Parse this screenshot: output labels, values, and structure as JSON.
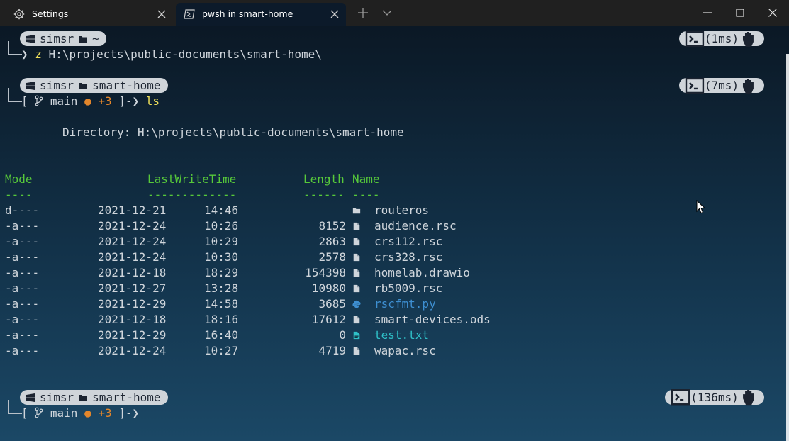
{
  "tabs": [
    {
      "label": "Settings",
      "icon": "gear-icon",
      "active": false
    },
    {
      "label": "pwsh in smart-home",
      "icon": "powershell-icon",
      "active": true
    }
  ],
  "prompts": [
    {
      "user": "simsr",
      "dir": "~",
      "time": "(1ms)",
      "command_prefix": "z",
      "command_arg": "H:\\projects\\public-documents\\smart-home\\"
    },
    {
      "user": "simsr",
      "dir": "smart-home",
      "time": "(7ms)",
      "branch": "main",
      "dirty": "●",
      "changes": "+3",
      "command": "ls"
    },
    {
      "user": "simsr",
      "dir": "smart-home",
      "time": "(136ms)",
      "branch": "main",
      "dirty": "●",
      "changes": "+3",
      "command": ""
    }
  ],
  "listing": {
    "directory": "Directory: H:\\projects\\public-documents\\smart-home",
    "headers": {
      "mode": "Mode",
      "lastwrite": "LastWriteTime",
      "length": "Length",
      "name": "Name"
    },
    "underlines": {
      "mode": "----",
      "lastwrite": "-------------",
      "length": "------",
      "name": "----"
    },
    "rows": [
      {
        "mode": "d----",
        "date": "2021-12-21",
        "time": "14:46",
        "length": "",
        "name": "routeros",
        "icon": "folder-icon",
        "color": "#cfd5db"
      },
      {
        "mode": "-a---",
        "date": "2021-12-24",
        "time": "10:26",
        "length": "8152",
        "name": "audience.rsc",
        "icon": "file-icon",
        "color": "#cfd5db"
      },
      {
        "mode": "-a---",
        "date": "2021-12-24",
        "time": "10:29",
        "length": "2863",
        "name": "crs112.rsc",
        "icon": "file-icon",
        "color": "#cfd5db"
      },
      {
        "mode": "-a---",
        "date": "2021-12-24",
        "time": "10:30",
        "length": "2578",
        "name": "crs328.rsc",
        "icon": "file-icon",
        "color": "#cfd5db"
      },
      {
        "mode": "-a---",
        "date": "2021-12-18",
        "time": "18:29",
        "length": "154398",
        "name": "homelab.drawio",
        "icon": "file-icon",
        "color": "#cfd5db"
      },
      {
        "mode": "-a---",
        "date": "2021-12-27",
        "time": "13:28",
        "length": "10980",
        "name": "rb5009.rsc",
        "icon": "file-icon",
        "color": "#cfd5db"
      },
      {
        "mode": "-a---",
        "date": "2021-12-29",
        "time": "14:58",
        "length": "3685",
        "name": "rscfmt.py",
        "icon": "python-icon",
        "color": "#3e8fd1"
      },
      {
        "mode": "-a---",
        "date": "2021-12-18",
        "time": "18:16",
        "length": "17612",
        "name": "smart-devices.ods",
        "icon": "file-icon",
        "color": "#cfd5db"
      },
      {
        "mode": "-a---",
        "date": "2021-12-29",
        "time": "16:40",
        "length": "0",
        "name": "test.txt",
        "icon": "text-file-icon",
        "color": "#2fc0c8"
      },
      {
        "mode": "-a---",
        "date": "2021-12-24",
        "time": "10:27",
        "length": "4719",
        "name": "wapac.rsc",
        "icon": "file-icon",
        "color": "#cfd5db"
      }
    ]
  },
  "colors": {
    "accent_green": "#57c93a",
    "git_orange": "#e3862b",
    "command_yellow": "#efe05a",
    "pill_bg": "#cfd4d9"
  }
}
